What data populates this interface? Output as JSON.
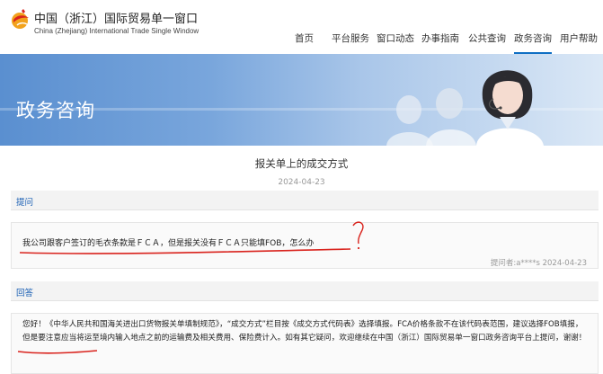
{
  "header": {
    "brand_cn": "中国（浙江）国际贸易单一窗口",
    "brand_en": "China (Zhejiang) International Trade Single Window",
    "nav": [
      "首页",
      "平台服务",
      "窗口动态",
      "办事指南",
      "公共查询",
      "政务咨询",
      "用户帮助"
    ],
    "active_nav": "政务咨询",
    "accent_color": "#0f6fc4"
  },
  "banner": {
    "title": "政务咨询"
  },
  "question": {
    "title": "报关单上的成交方式",
    "date": "2024-04-23",
    "section_label": "提问",
    "text": "我公司跟客户签订的毛衣条款是ＦＣＡ，但是报关没有ＦＣＡ只能填FOB，怎么办",
    "asker_meta": "提问者:a****s 2024-04-23"
  },
  "answer": {
    "section_label": "回答",
    "text": "您好！《中华人民共和国海关进出口货物报关单填制规范》，“成交方式”栏目按《成交方式代码表》选择填报。FCA价格条款不在该代码表范围，建议选择FOB填报，但是要注意应当将运至境内输入地点之前的运输费及相关费用、保险费计入。如有其它疑问，欢迎继续在中国（浙江）国际贸易单一窗口政务咨询平台上提问，谢谢！"
  }
}
